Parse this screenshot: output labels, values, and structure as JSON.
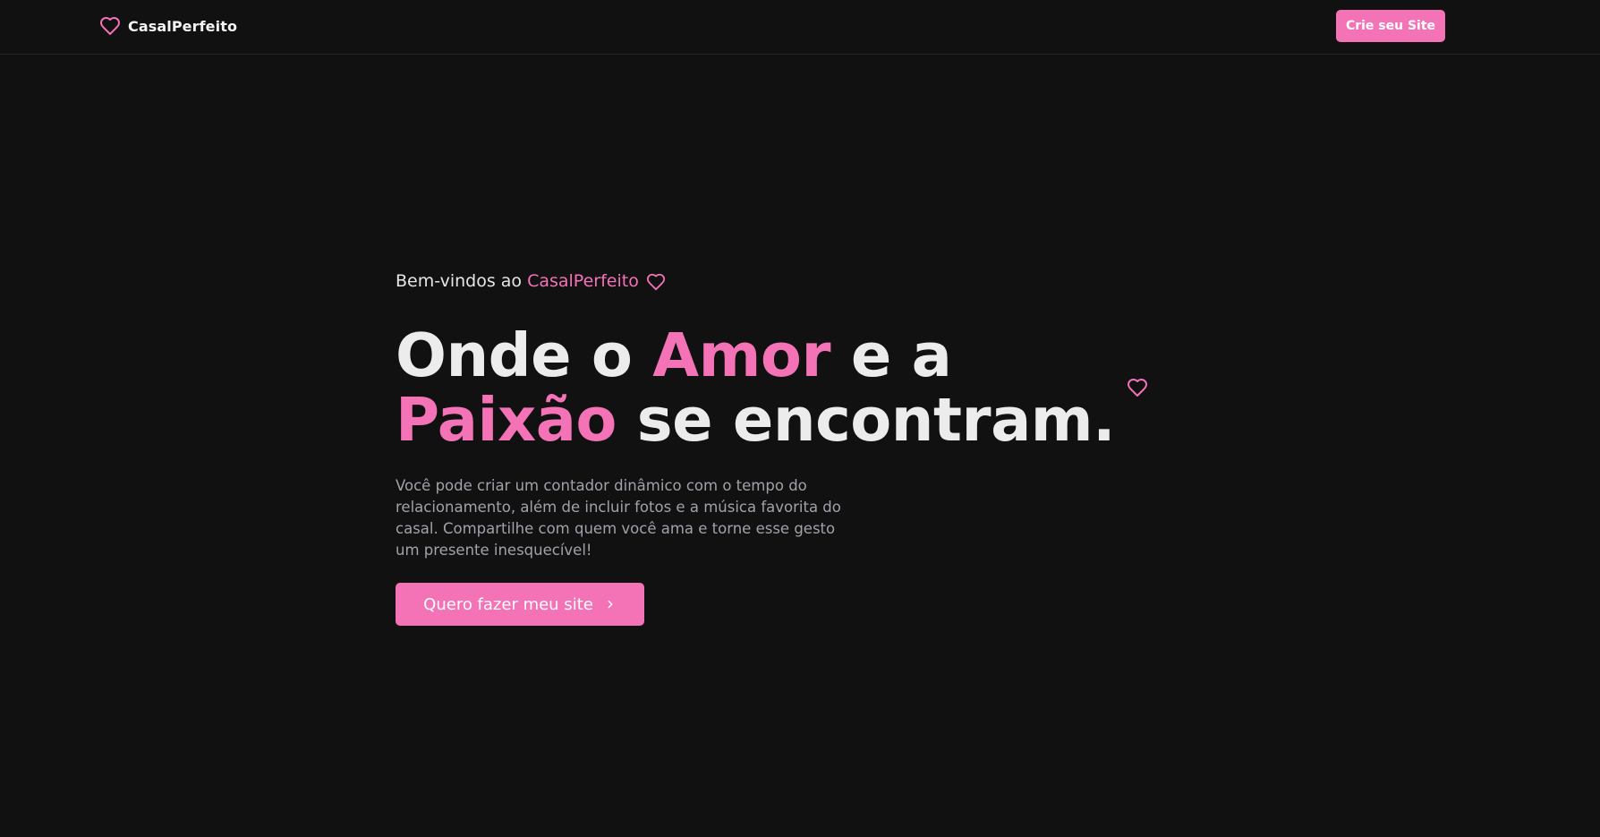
{
  "navbar": {
    "brand_name": "CasalPerfeito",
    "brand_icon": "heart-icon",
    "cta_label": "Crie seu Site"
  },
  "hero": {
    "welcome_prefix": "Bem-vindos ao ",
    "welcome_brand": "CasalPerfeito",
    "welcome_icon": "heart-icon",
    "headline": {
      "part1": "Onde o ",
      "highlight1": "Amor",
      "part2": " e a",
      "highlight2": "Paixão",
      "part3": " se encontram."
    },
    "description": "Você pode criar um contador dinâmico com o tempo do relacionamento, além de incluir fotos e a música favorita do casal. Compartilhe com quem você ama e torne esse gesto um presente inesquecível!",
    "cta_label": "Quero fazer meu site",
    "cta_icon": "chevron-right-icon",
    "decoration_icon": "heart-icon"
  },
  "colors": {
    "background": "#111112",
    "accent": "#f472b6",
    "text": "#ececec",
    "muted_text": "#a1a1aa"
  }
}
